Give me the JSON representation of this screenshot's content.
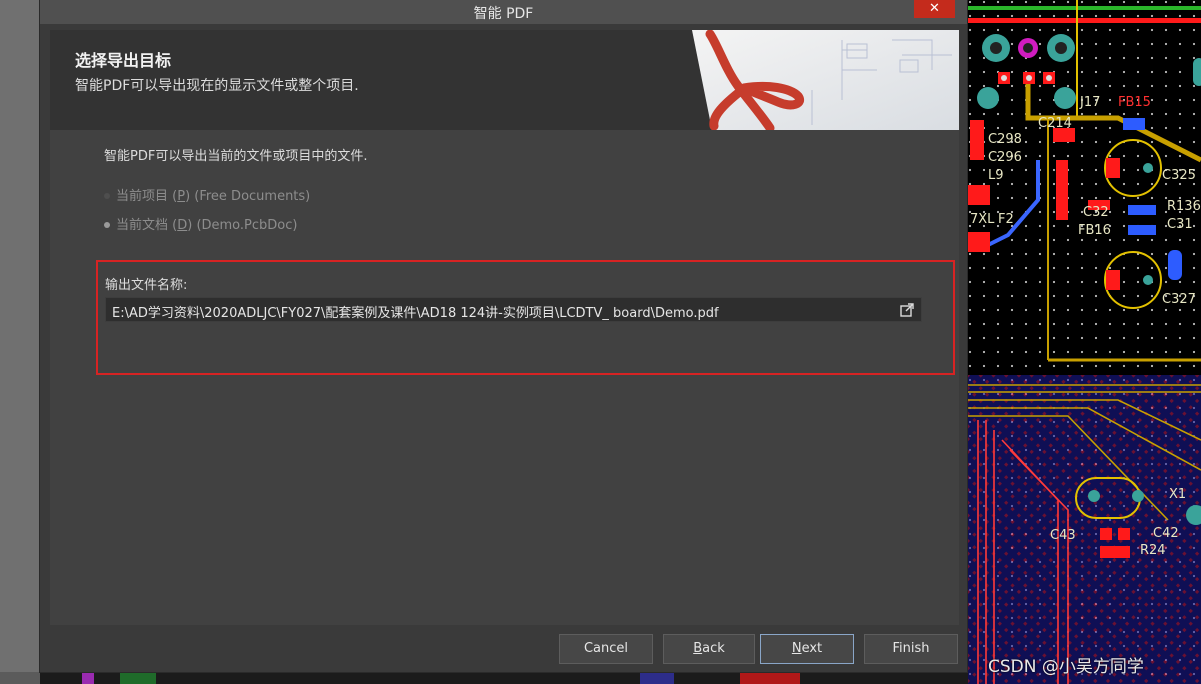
{
  "window": {
    "title": "智能 PDF",
    "close_glyph": "✕"
  },
  "header": {
    "title": "选择导出目标",
    "subtitle": "智能PDF可以导出现在的显示文件或整个项目."
  },
  "description": "智能PDF可以导出当前的文件或项目中的文件.",
  "options": [
    {
      "label_pre": "当前项目 (",
      "accel": "P",
      "label_post": ") (Free Documents)",
      "selected": false
    },
    {
      "label_pre": "当前文档 (",
      "accel": "D",
      "label_post": ") (Demo.PcbDoc)",
      "selected": true
    }
  ],
  "output": {
    "label": "输出文件名称:",
    "path": "E:\\AD学习资料\\2020ADLJC\\FY027\\配套案例及课件\\AD18 124讲-实例项目\\LCDTV_ board\\Demo.pdf",
    "browse_icon": "browse-icon"
  },
  "buttons": {
    "cancel": "Cancel",
    "back_accel": "B",
    "back_rest": "ack",
    "next_accel": "N",
    "next_rest": "ext",
    "finish": "Finish"
  },
  "pcb": {
    "labels": [
      "J17",
      "FB15",
      "C214",
      "C298",
      "C296",
      "L9",
      "F2",
      "7XL",
      "C32",
      "FB16",
      "R136",
      "C31",
      "C327",
      "X1",
      "C43",
      "C42",
      "R24",
      "C325"
    ],
    "watermark": "CSDN @小吴方同学"
  },
  "colors": {
    "accent_red": "#d72323",
    "close_red": "#c42b1c",
    "pcb_bg": "#000000",
    "copper_red": "#ff1a1a",
    "pad_teal": "#3aa39a",
    "track_yellow": "#c8a000",
    "track_blue": "#3a66ff"
  }
}
